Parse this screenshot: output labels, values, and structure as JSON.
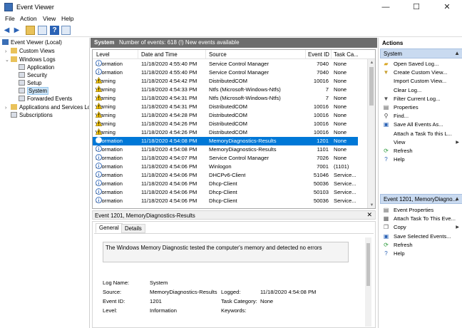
{
  "window": {
    "title": "Event Viewer",
    "minimize": "—",
    "maximize": "☐",
    "close": "✕"
  },
  "menu": [
    "File",
    "Action",
    "View",
    "Help"
  ],
  "tree": {
    "root": "Event Viewer (Local)",
    "custom_views": "Custom Views",
    "windows_logs": "Windows Logs",
    "application": "Application",
    "security": "Security",
    "setup": "Setup",
    "system": "System",
    "forwarded": "Forwarded Events",
    "apps_services": "Applications and Services Lo",
    "subscriptions": "Subscriptions"
  },
  "log_header": {
    "name": "System",
    "info": "Number of events: 618 (!) New events available"
  },
  "columns": {
    "level": "Level",
    "date": "Date and Time",
    "source": "Source",
    "event_id": "Event ID",
    "task": "Task Ca..."
  },
  "events": [
    {
      "level": "Information",
      "date": "11/18/2020 4:55:40 PM",
      "source": "Service Control Manager",
      "id": "7040",
      "task": "None"
    },
    {
      "level": "Information",
      "date": "11/18/2020 4:55:40 PM",
      "source": "Service Control Manager",
      "id": "7040",
      "task": "None"
    },
    {
      "level": "Warning",
      "date": "11/18/2020 4:54:42 PM",
      "source": "DistributedCOM",
      "id": "10016",
      "task": "None"
    },
    {
      "level": "Warning",
      "date": "11/18/2020 4:54:33 PM",
      "source": "Ntfs (Microsoft-Windows-Ntfs)",
      "id": "7",
      "task": "None"
    },
    {
      "level": "Warning",
      "date": "11/18/2020 4:54:31 PM",
      "source": "Ntfs (Microsoft-Windows-Ntfs)",
      "id": "7",
      "task": "None"
    },
    {
      "level": "Warning",
      "date": "11/18/2020 4:54:31 PM",
      "source": "DistributedCOM",
      "id": "10016",
      "task": "None"
    },
    {
      "level": "Warning",
      "date": "11/18/2020 4:54:28 PM",
      "source": "DistributedCOM",
      "id": "10016",
      "task": "None"
    },
    {
      "level": "Warning",
      "date": "11/18/2020 4:54:26 PM",
      "source": "DistributedCOM",
      "id": "10016",
      "task": "None"
    },
    {
      "level": "Warning",
      "date": "11/18/2020 4:54:26 PM",
      "source": "DistributedCOM",
      "id": "10016",
      "task": "None"
    },
    {
      "level": "Information",
      "date": "11/18/2020 4:54:08 PM",
      "source": "MemoryDiagnostics-Results",
      "id": "1201",
      "task": "None",
      "selected": true
    },
    {
      "level": "Information",
      "date": "11/18/2020 4:54:08 PM",
      "source": "MemoryDiagnostics-Results",
      "id": "1101",
      "task": "None"
    },
    {
      "level": "Information",
      "date": "11/18/2020 4:54:07 PM",
      "source": "Service Control Manager",
      "id": "7026",
      "task": "None"
    },
    {
      "level": "Information",
      "date": "11/18/2020 4:54:06 PM",
      "source": "Winlogon",
      "id": "7001",
      "task": "(1101)"
    },
    {
      "level": "Information",
      "date": "11/18/2020 4:54:06 PM",
      "source": "DHCPv6-Client",
      "id": "51046",
      "task": "Service..."
    },
    {
      "level": "Information",
      "date": "11/18/2020 4:54:06 PM",
      "source": "Dhcp-Client",
      "id": "50036",
      "task": "Service..."
    },
    {
      "level": "Information",
      "date": "11/18/2020 4:54:06 PM",
      "source": "Dhcp-Client",
      "id": "50103",
      "task": "Service..."
    },
    {
      "level": "Information",
      "date": "11/18/2020 4:54:06 PM",
      "source": "Dhcp-Client",
      "id": "50036",
      "task": "Service..."
    }
  ],
  "detail": {
    "title": "Event 1201, MemoryDiagnostics-Results",
    "tab_general": "General",
    "tab_details": "Details",
    "message": "The Windows Memory Diagnostic tested the computer's memory and detected no errors",
    "log_name_label": "Log Name:",
    "log_name": "System",
    "source_label": "Source:",
    "source": "MemoryDiagnostics-Results",
    "logged_label": "Logged:",
    "logged": "11/18/2020 4:54:08 PM",
    "event_id_label": "Event ID:",
    "event_id": "1201",
    "task_label": "Task Category:",
    "task": "None",
    "level_label": "Level:",
    "level": "Information",
    "keywords_label": "Keywords:",
    "keywords": ""
  },
  "actions": {
    "title": "Actions",
    "section1": "System",
    "items1": [
      "Open Saved Log...",
      "Create Custom View...",
      "Import Custom View...",
      "Clear Log...",
      "Filter Current Log...",
      "Properties",
      "Find...",
      "Save All Events As...",
      "Attach a Task To this L...",
      "View",
      "Refresh",
      "Help"
    ],
    "section2": "Event 1201, MemoryDiagno...",
    "items2": [
      "Event Properties",
      "Attach Task To This Eve...",
      "Copy",
      "Save Selected Events...",
      "Refresh",
      "Help"
    ]
  },
  "colors": {
    "selection": "#0078d7",
    "section_bg": "#c9daf0",
    "header_bg": "#6d6d6d"
  }
}
